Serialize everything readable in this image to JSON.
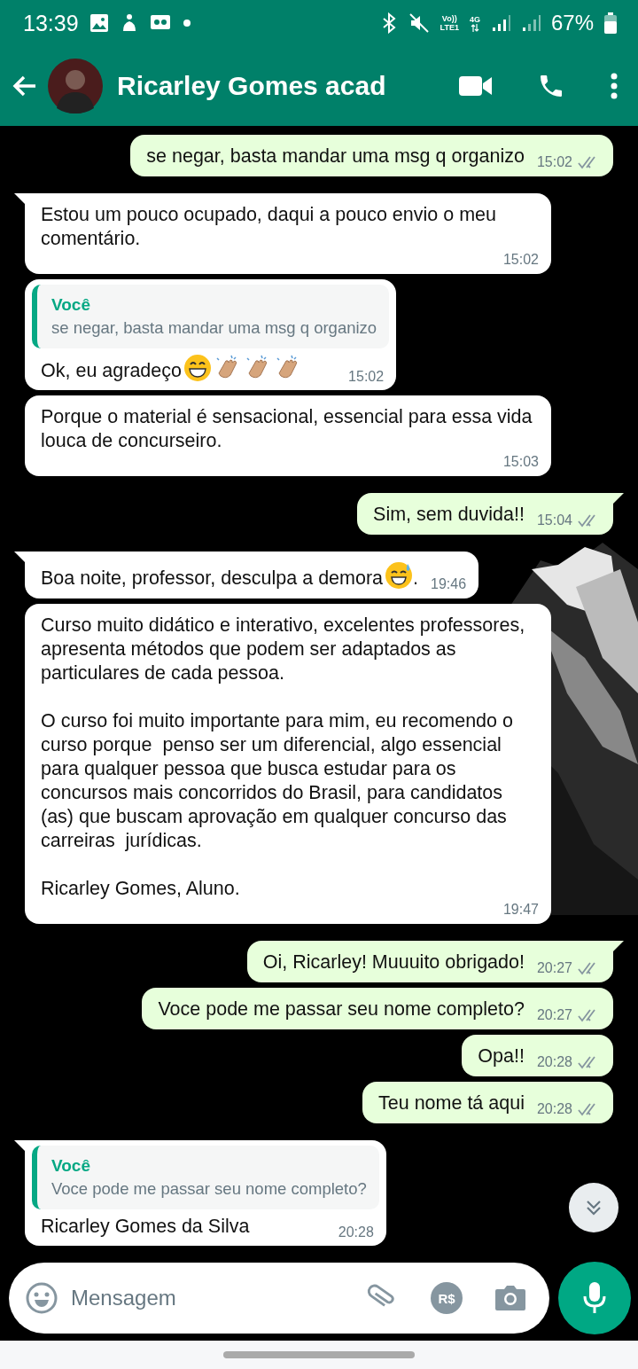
{
  "status_bar": {
    "time": "13:39",
    "battery": "67%",
    "network_top": "Vo))",
    "network_bottom": "LTE1",
    "data_label": "4G"
  },
  "header": {
    "title": "Ricarley Gomes acad"
  },
  "messages": [
    {
      "kind": "out",
      "tail": false,
      "text": "se negar, basta mandar uma msg q organizo",
      "time": "15:02",
      "read": false
    },
    {
      "kind": "in",
      "tail": true,
      "text": "Estou um pouco ocupado, daqui a pouco envio o meu comentário.",
      "time": "15:02"
    },
    {
      "kind": "in",
      "tail": false,
      "quote": {
        "author": "Você",
        "text": "se negar, basta mandar uma msg q organizo"
      },
      "text": "Ok, eu agradeço",
      "emojis": [
        {
          "kind": "grin"
        },
        {
          "kind": "clap"
        },
        {
          "kind": "clap"
        },
        {
          "kind": "clap"
        }
      ],
      "time": "15:02"
    },
    {
      "kind": "in",
      "tail": false,
      "text": "Porque o material é sensacional, essencial para essa vida louca de concurseiro.",
      "time": "15:03"
    },
    {
      "kind": "out",
      "tail": true,
      "text": "Sim, sem duvida!!",
      "time": "15:04",
      "read": false
    },
    {
      "kind": "in",
      "tail": true,
      "text": "Boa noite, professor, desculpa a demora",
      "emojis": [
        {
          "kind": "sweat"
        }
      ],
      "text_after": ".",
      "time": "19:46"
    },
    {
      "kind": "in",
      "tail": false,
      "text": "Curso muito didático e interativo, excelentes professores, apresenta métodos que podem ser adaptados as particulares de cada pessoa.\n\nO curso foi muito importante para mim, eu recomendo o curso porque  penso ser um diferencial, algo essencial para qualquer pessoa que busca estudar para os concursos mais concorridos do Brasil, para candidatos (as) que buscam aprovação em qualquer concurso das carreiras  jurídicas.\n\nRicarley Gomes, Aluno.",
      "time": "19:47"
    },
    {
      "kind": "out",
      "tail": true,
      "text": "Oi, Ricarley! Muuuito obrigado!",
      "time": "20:27",
      "read": false
    },
    {
      "kind": "out",
      "tail": false,
      "text": "Voce pode me passar seu nome completo?",
      "time": "20:27",
      "read": false
    },
    {
      "kind": "out",
      "tail": false,
      "text": "Opa!!",
      "time": "20:28",
      "read": false
    },
    {
      "kind": "out",
      "tail": false,
      "text": "Teu nome tá aqui",
      "time": "20:28",
      "read": false
    },
    {
      "kind": "in",
      "tail": true,
      "quote": {
        "author": "Você",
        "text": "Voce pode me passar seu nome completo?"
      },
      "text": "Ricarley Gomes da Silva",
      "time": "20:28"
    }
  ],
  "composer": {
    "placeholder": "Mensagem",
    "payment_label": "R$"
  }
}
